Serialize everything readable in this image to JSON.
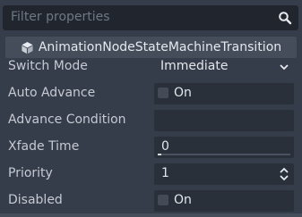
{
  "filter": {
    "placeholder": "Filter properties",
    "icon": "search-icon"
  },
  "header": {
    "title": "AnimationNodeStateMachineTransition",
    "icon": "cube-icon"
  },
  "properties": {
    "switch_mode": {
      "label": "Switch Mode",
      "value": "Immediate"
    },
    "auto_advance": {
      "label": "Auto Advance",
      "checked": false,
      "value": "On"
    },
    "advance_condition": {
      "label": "Advance Condition",
      "value": ""
    },
    "xfade_time": {
      "label": "Xfade Time",
      "value": "0",
      "level": 0
    },
    "priority": {
      "label": "Priority",
      "value": "1"
    },
    "disabled": {
      "label": "Disabled",
      "checked": false,
      "value": "On"
    }
  },
  "colors": {
    "background": "#363d4a",
    "field": "#2a303a",
    "header": "#454d5b",
    "text": "#d0d4db"
  }
}
